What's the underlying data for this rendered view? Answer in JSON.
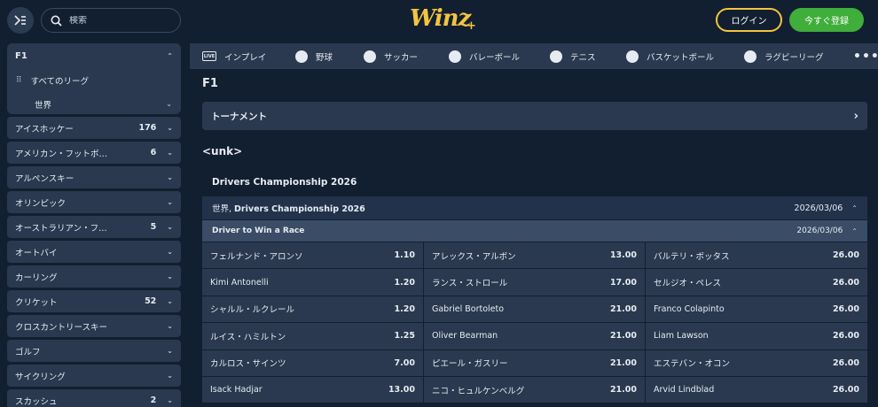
{
  "header": {
    "search_placeholder": "検索",
    "logo": "Winz",
    "logo_plus": "+",
    "login": "ログイン",
    "register": "今すぐ登録"
  },
  "sidebar": {
    "f1": {
      "label": "F1",
      "all_leagues": "すべてのリーグ",
      "world": "世界"
    },
    "sports": [
      {
        "label": "アイスホッケー",
        "count": "176"
      },
      {
        "label": "アメリカン・フットボ…",
        "count": "6"
      },
      {
        "label": "アルペンスキー",
        "count": ""
      },
      {
        "label": "オリンピック",
        "count": ""
      },
      {
        "label": "オーストラリアン・フ…",
        "count": "5"
      },
      {
        "label": "オートバイ",
        "count": ""
      },
      {
        "label": "カーリング",
        "count": ""
      },
      {
        "label": "クリケット",
        "count": "52"
      },
      {
        "label": "クロスカントリースキー",
        "count": ""
      },
      {
        "label": "ゴルフ",
        "count": ""
      },
      {
        "label": "サイクリング",
        "count": ""
      },
      {
        "label": "スカッシュ",
        "count": "2"
      }
    ]
  },
  "sportnav": {
    "items": [
      {
        "label": "インプレイ",
        "icon": "live-icon"
      },
      {
        "label": "野球",
        "icon": "baseball-icon"
      },
      {
        "label": "サッカー",
        "icon": "soccer-icon"
      },
      {
        "label": "バレーボール",
        "icon": "volleyball-icon"
      },
      {
        "label": "テニス",
        "icon": "tennis-icon"
      },
      {
        "label": "バスケットボール",
        "icon": "basketball-icon"
      },
      {
        "label": "ラグビーリーグ",
        "icon": "rugby-icon"
      }
    ],
    "more": "•••"
  },
  "main": {
    "title": "F1",
    "tournament": "トーナメント",
    "section": "<unk>",
    "competition": "Drivers Championship 2026",
    "comp_header_prefix": "世界, ",
    "comp_header_name": "Drivers Championship 2026",
    "comp_header_date": "2026/03/06",
    "market_name": "Driver to Win a Race",
    "market_date": "2026/03/06",
    "rows": [
      [
        {
          "name": "フェルナンド・アロンソ",
          "odds": "1.10"
        },
        {
          "name": "アレックス・アルボン",
          "odds": "13.00"
        },
        {
          "name": "バルテリ・ボッタス",
          "odds": "26.00"
        }
      ],
      [
        {
          "name": "Kimi Antonelli",
          "odds": "1.20"
        },
        {
          "name": "ランス・ストロール",
          "odds": "17.00"
        },
        {
          "name": "セルジオ・ペレス",
          "odds": "26.00"
        }
      ],
      [
        {
          "name": "シャルル・ルクレール",
          "odds": "1.20"
        },
        {
          "name": "Gabriel Bortoleto",
          "odds": "21.00"
        },
        {
          "name": "Franco Colapinto",
          "odds": "26.00"
        }
      ],
      [
        {
          "name": "ルイス・ハミルトン",
          "odds": "1.25"
        },
        {
          "name": "Oliver Bearman",
          "odds": "21.00"
        },
        {
          "name": "Liam Lawson",
          "odds": "26.00"
        }
      ],
      [
        {
          "name": "カルロス・サインツ",
          "odds": "7.00"
        },
        {
          "name": "ピエール・ガスリー",
          "odds": "21.00"
        },
        {
          "name": "エステバン・オコン",
          "odds": "26.00"
        }
      ],
      [
        {
          "name": "Isack Hadjar",
          "odds": "13.00"
        },
        {
          "name": "ニコ・ヒュルケンベルグ",
          "odds": "21.00"
        },
        {
          "name": "Arvid Lindblad",
          "odds": "26.00"
        }
      ]
    ]
  },
  "colors": {
    "background": "#121f30",
    "panel": "#2a394f",
    "accent_gold": "#f3c43f",
    "register_green": "#3fae3a"
  }
}
